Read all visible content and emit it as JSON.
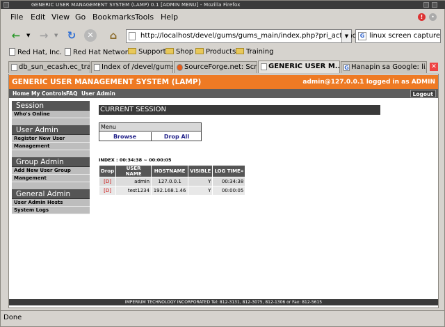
{
  "window": {
    "title": "GENERIC USER MANAGEMENT SYSTEM (LAMP) 0.1 [ADMIN MENU] - Mozilla Firefox"
  },
  "menubar": [
    "File",
    "Edit",
    "View",
    "Go",
    "Bookmarks",
    "Tools",
    "Help"
  ],
  "navbar": {
    "url": "http://localhost/devel/gums/gums_main/index.php?pri_act=admin",
    "search": "linux screen capture"
  },
  "bookmarks": [
    {
      "label": "Red Hat, Inc.",
      "type": "page"
    },
    {
      "label": "Red Hat Network",
      "type": "page"
    },
    {
      "label": "Support",
      "type": "folder"
    },
    {
      "label": "Shop",
      "type": "folder"
    },
    {
      "label": "Products",
      "type": "folder"
    },
    {
      "label": "Training",
      "type": "folder"
    }
  ],
  "tabs": [
    {
      "label": "db_sun_ecash.ec_tra...",
      "active": false
    },
    {
      "label": "Index of /devel/gums",
      "active": false
    },
    {
      "label": "SourceForge.net: Scr...",
      "active": false
    },
    {
      "label": "GENERIC USER M...",
      "active": true
    },
    {
      "label": "Hanapin sa Google: li...",
      "active": false
    }
  ],
  "app": {
    "header_title": "GENERIC USER MANAGEMENT SYSTEM (LAMP)",
    "header_login": "admin@127.0.0.1 logged in as ADMIN",
    "topnav": [
      "Home",
      "My Controls",
      "FAQ",
      "User Admin"
    ],
    "logout": "Logout",
    "sidebar": [
      {
        "heading": "Session",
        "items": [
          "Who's Online"
        ]
      },
      {
        "heading": "User Admin",
        "items": [
          "Register New User",
          "Management"
        ]
      },
      {
        "heading": "Group Admin",
        "items": [
          "Add New User Group",
          "Mangement"
        ]
      },
      {
        "heading": "General Admin",
        "items": [
          "User Admin Hosts",
          "System Logs"
        ]
      }
    ],
    "section_title": "CURRENT SESSION",
    "menu_label": "Menu",
    "menu_buttons": [
      "Browse",
      "Drop All"
    ],
    "index_line": "INDEX : 00:34:38 ~ 00:00:05",
    "table": {
      "headers": [
        "Drop",
        "USER NAME",
        "HOSTNAME",
        "VISIBLE",
        "LOG TIME»"
      ],
      "rows": [
        [
          "[D]",
          "admin",
          "127.0.0.1",
          "Y",
          "00:34:38"
        ],
        [
          "[D]",
          "test1234",
          "192.168.1.46",
          "Y",
          "00:00:05"
        ]
      ]
    },
    "footer": "IMPERIUM TECHNOLOGY INCORPORATED Tel: 812-3131, 812-3075, 812-1306 or Fax: 812-5615"
  },
  "status": "Done",
  "colors": {
    "accent": "#ee7a24",
    "dark_bar": "#3a3a3a",
    "nav_bar": "#5e5e5e"
  },
  "icons": [
    "back-arrow-icon",
    "forward-arrow-icon",
    "reload-icon",
    "stop-icon",
    "home-icon",
    "error-icon",
    "page-icon",
    "folder-icon",
    "google-icon",
    "tab-close-icon"
  ]
}
